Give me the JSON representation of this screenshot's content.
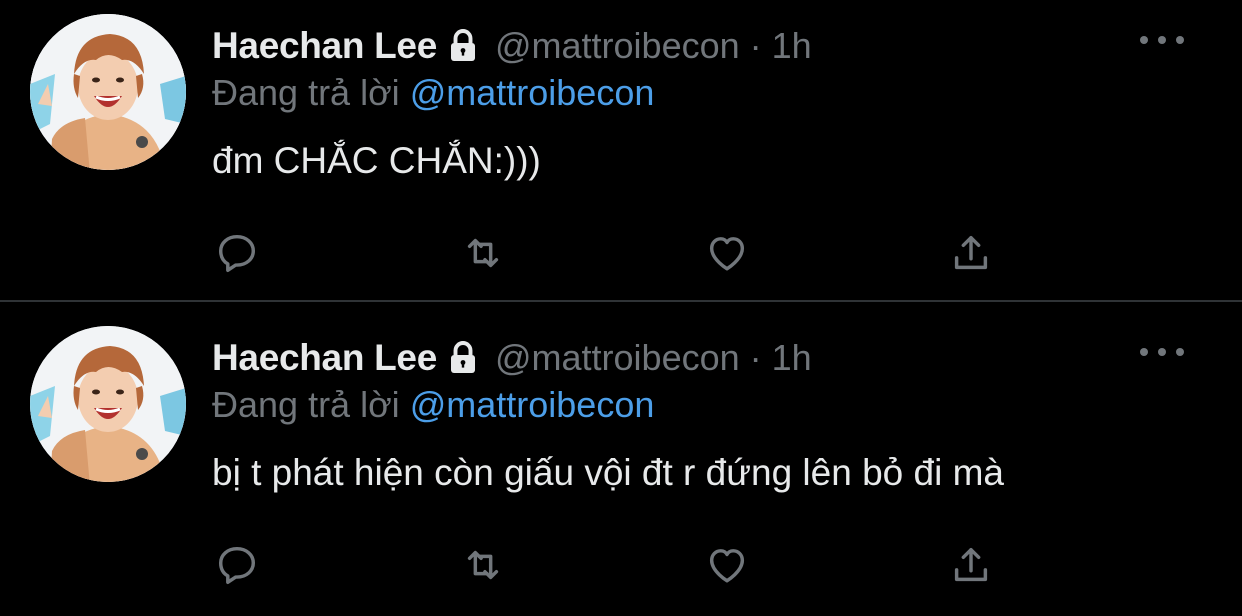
{
  "tweets": [
    {
      "author_name": "Haechan Lee",
      "handle": "@mattroibecon",
      "separator": "·",
      "time": "1h",
      "reply_prefix": "Đang trả lời",
      "reply_to": "@mattroibecon",
      "text": "đm CHẮC CHẮN:)))"
    },
    {
      "author_name": "Haechan Lee",
      "handle": "@mattroibecon",
      "separator": "·",
      "time": "1h",
      "reply_prefix": "Đang trả lời",
      "reply_to": "@mattroibecon",
      "text": "bị t phát hiện còn giấu vội đt r đứng lên bỏ đi mà"
    }
  ],
  "icons": {
    "reply": "reply-icon",
    "retweet": "retweet-icon",
    "like": "heart-icon",
    "share": "share-icon",
    "more": "more-icon",
    "lock": "lock-icon"
  },
  "colors": {
    "background": "#000000",
    "mention": "#4c9ee8",
    "muted": "#71767b",
    "text": "#e7e9ea"
  }
}
